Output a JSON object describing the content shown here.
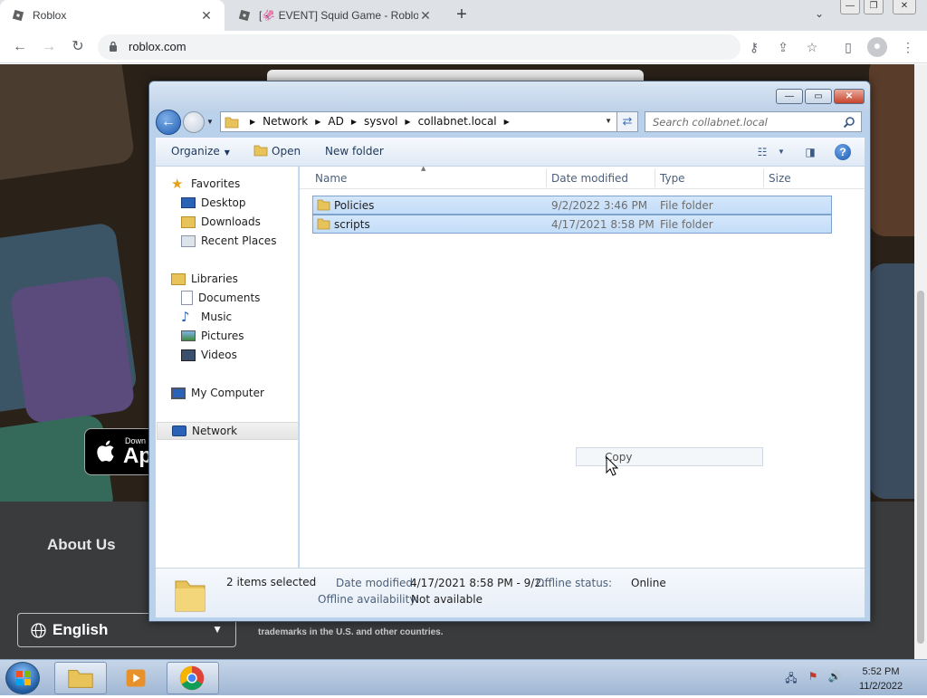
{
  "browser": {
    "tabs": [
      {
        "title": "Roblox",
        "active": true
      },
      {
        "title": "[🦑 EVENT] Squid Game - Roblox",
        "active": false
      }
    ],
    "new_tab_symbol": "+",
    "url": "roblox.com"
  },
  "roblox_page": {
    "app_store_small": "Down",
    "app_store_big": "Ap",
    "about_us": "About Us",
    "language": "English",
    "trademark_text": "trademarks in the U.S. and other countries."
  },
  "explorer": {
    "breadcrumbs": [
      "Network",
      "AD",
      "sysvol",
      "collabnet.local"
    ],
    "search_placeholder": "Search collabnet.local",
    "commands": {
      "organize": "Organize",
      "open": "Open",
      "new_folder": "New folder"
    },
    "nav": {
      "favorites": "Favorites",
      "desktop": "Desktop",
      "downloads": "Downloads",
      "recent_places": "Recent Places",
      "libraries": "Libraries",
      "documents": "Documents",
      "music": "Music",
      "pictures": "Pictures",
      "videos": "Videos",
      "my_computer": "My Computer",
      "network": "Network"
    },
    "columns": {
      "name": "Name",
      "date_modified": "Date modified",
      "type": "Type",
      "size": "Size"
    },
    "files": [
      {
        "name": "Policies",
        "date": "9/2/2022 3:46 PM",
        "type": "File folder"
      },
      {
        "name": "scripts",
        "date": "4/17/2021 8:58 PM",
        "type": "File folder"
      }
    ],
    "drag_tooltip": "Copy",
    "details": {
      "count": "2 items selected",
      "date_modified_label": "Date modified:",
      "date_modified_value": "4/17/2021 8:58 PM - 9/2...",
      "offline_status_label": "Offline status:",
      "offline_status_value": "Online",
      "offline_availability_label": "Offline availability:",
      "offline_availability_value": "Not available"
    }
  },
  "taskbar": {
    "time": "5:52 PM",
    "date": "11/2/2022"
  },
  "colors": {
    "selection": "#cce4fb",
    "explorer_frame": "#b9d1ea",
    "taskbar": "#b3c7e0"
  }
}
